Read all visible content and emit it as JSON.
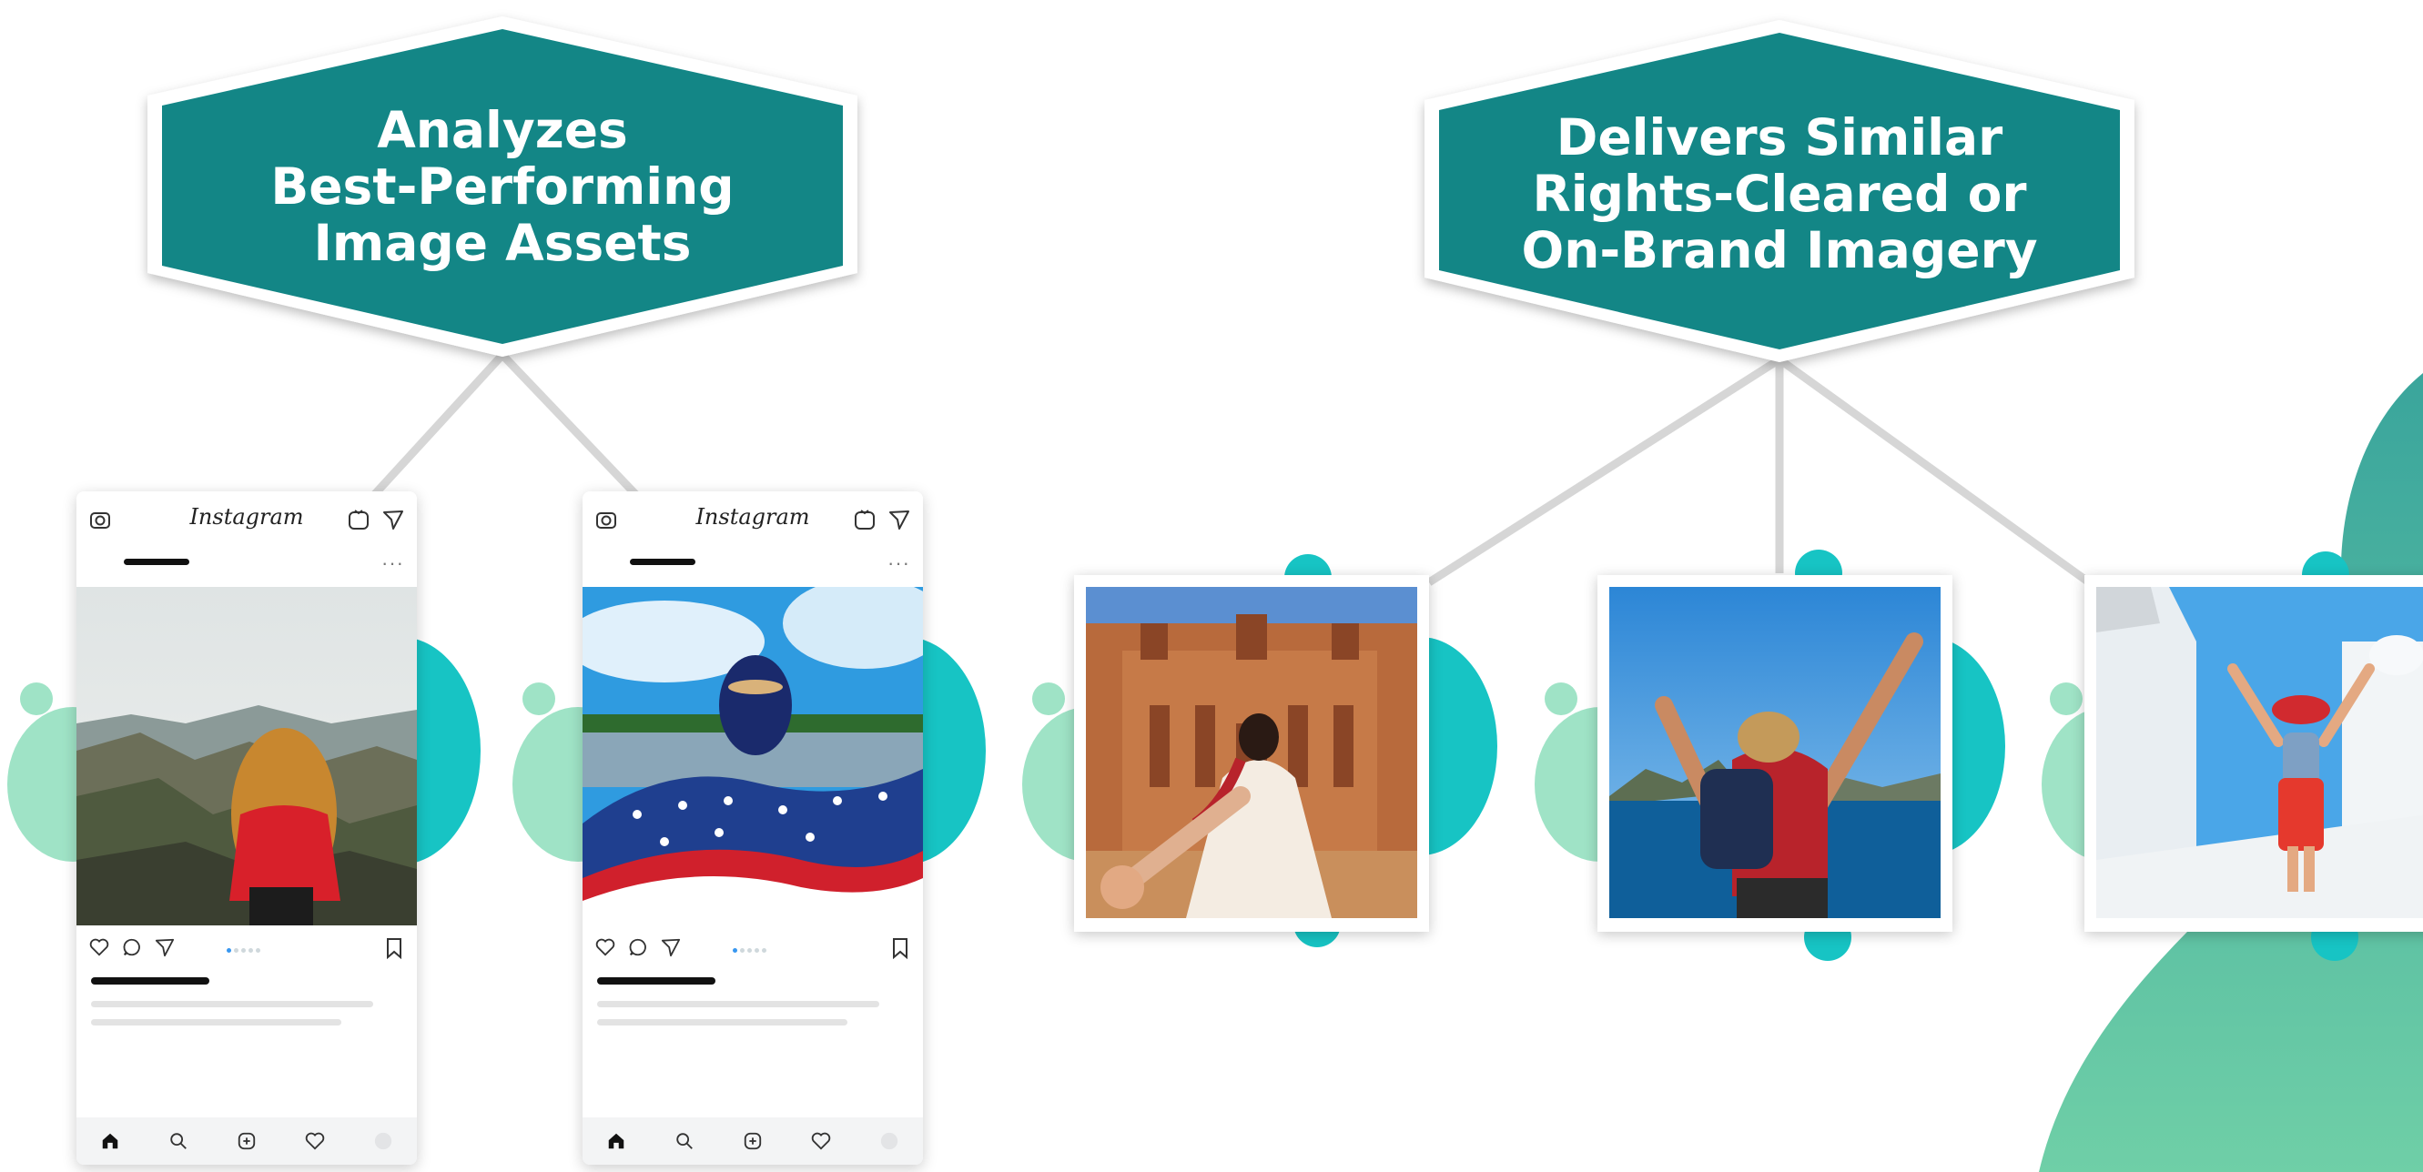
{
  "headings": {
    "left": [
      "Analyzes",
      "Best-Performing",
      "Image Assets"
    ],
    "right": [
      "Delivers Similar",
      "Rights-Cleared or",
      "On-Brand Imagery"
    ]
  },
  "phone_app_name": "Instagram",
  "icons": {
    "phone_top": [
      "camera-icon",
      "igtv-icon",
      "direct-message-icon"
    ],
    "phone_actions": [
      "heart-icon",
      "comment-icon",
      "share-icon",
      "bookmark-icon"
    ],
    "phone_nav": [
      "home-icon",
      "search-icon",
      "add-post-icon",
      "activity-icon",
      "profile-icon"
    ]
  },
  "colors": {
    "teal_dark": "#138686",
    "teal_light": "#17c4c4",
    "mint": "#9fe3c6",
    "blob": "#4dbf9f",
    "connector": "#d9d9d9"
  }
}
